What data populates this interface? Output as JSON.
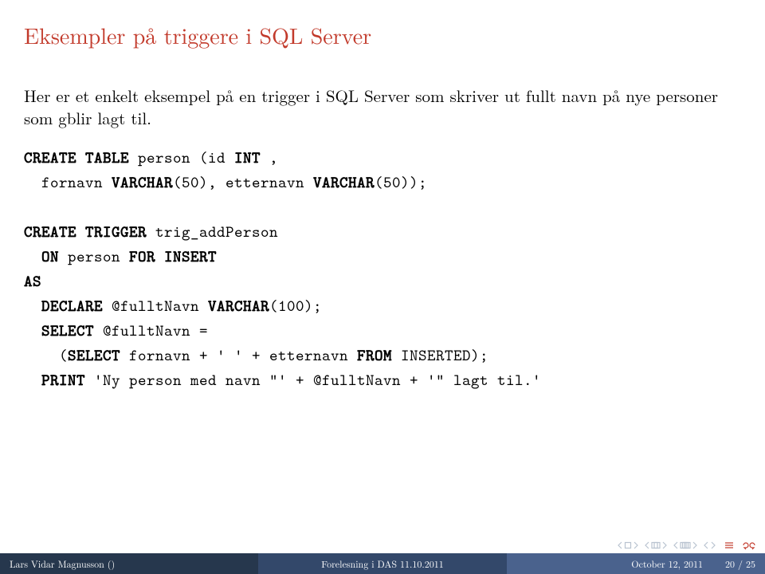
{
  "title": "Eksempler på triggere i SQL Server",
  "intro": "Her er et enkelt eksempel på en trigger i SQL Server som skriver ut fullt navn på nye personer som gblir lagt til.",
  "code": {
    "l1a": "CREATE TABLE",
    "l1b": " person (id ",
    "l1c": "INT",
    "l1d": " ,",
    "l2a": "  fornavn ",
    "l2b": "VARCHAR",
    "l2c": "(50), etternavn ",
    "l2d": "VARCHAR",
    "l2e": "(50));",
    "l3a": "CREATE TRIGGER",
    "l3b": " trig_addPerson",
    "l4a": "  ",
    "l4b": "ON",
    "l4c": " person ",
    "l4d": "FOR INSERT",
    "l5": "AS",
    "l6a": "  ",
    "l6b": "DECLARE",
    "l6c": " @fulltNavn ",
    "l6d": "VARCHAR",
    "l6e": "(100);",
    "l7a": "  ",
    "l7b": "SELECT",
    "l7c": " @fulltNavn =",
    "l8a": "    (",
    "l8b": "SELECT",
    "l8c": " fornavn + ' ' + etternavn ",
    "l8d": "FROM",
    "l8e": " INSERTED);",
    "l9a": "  ",
    "l9b": "PRINT",
    "l9c": " 'Ny person med navn \"' + @fulltNavn + '\" lagt til.'"
  },
  "footer": {
    "left": "Lars Vidar Magnusson ()",
    "mid": "Forelesning i DAS 11.10.2011",
    "right_date": "October 12, 2011",
    "right_page": "20 / 25"
  }
}
